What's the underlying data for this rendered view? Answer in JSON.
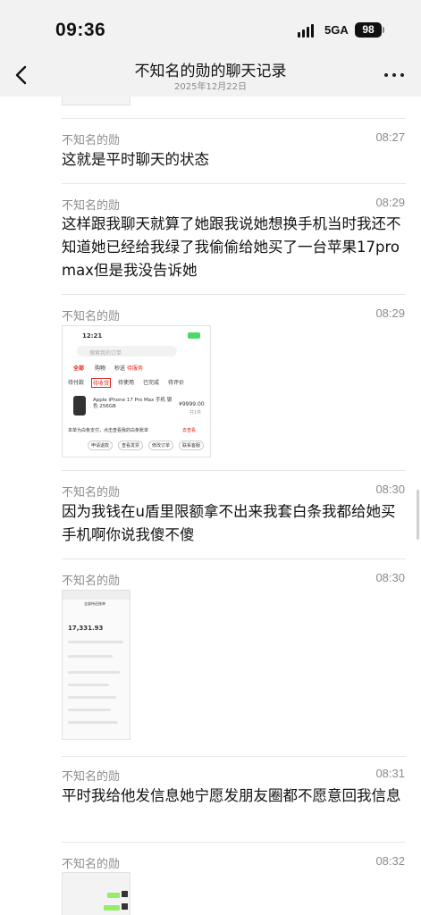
{
  "status_bar": {
    "time": "09:36",
    "network": "5GA",
    "battery": "98"
  },
  "nav": {
    "title": "不知名的勋的聊天记录",
    "subtitle": "2025年12月22日"
  },
  "messages": [
    {
      "sender": "不知名的勋",
      "time": "08:27",
      "text": "这就是平时聊天的状态"
    },
    {
      "sender": "不知名的勋",
      "time": "08:29",
      "text": "这样跟我聊天就算了她跟我说她想换手机当时我还不知道她已经给我绿了我偷偷给她买了一台苹果17pro max但是我没告诉她"
    },
    {
      "sender": "不知名的勋",
      "time": "08:29",
      "image": "order-screenshot"
    },
    {
      "sender": "不知名的勋",
      "time": "08:30",
      "text": "因为我钱在u盾里限额拿不出来我套白条我都给她买手机啊你说我傻不傻"
    },
    {
      "sender": "不知名的勋",
      "time": "08:30",
      "image": "bill-screenshot"
    },
    {
      "sender": "不知名的勋",
      "time": "08:31",
      "text": "平时我给他发信息她宁愿发朋友圈都不愿意回我信息"
    },
    {
      "sender": "不知名的勋",
      "time": "08:32",
      "image": "chat-screenshot"
    }
  ],
  "order_thumb": {
    "time": "12:21",
    "search_placeholder": "搜索我的订单",
    "tabs": [
      "全部",
      "购物",
      "秒送"
    ],
    "badge": "待服务",
    "filters": [
      "待付款",
      "待收货",
      "待使用",
      "已完成",
      "待评价"
    ],
    "product_name": "Apple iPhone 17 Pro Max 手机 银色 256GB",
    "price": "¥9999.00",
    "qty": "共1件",
    "notice": "本单为白条支付，点击查看我的白条账单",
    "notice_link": "去查看",
    "buttons": [
      "申请退款",
      "查看发票",
      "修改订单",
      "联系客服"
    ]
  },
  "bill_thumb": {
    "title": "全部待还账单",
    "amount": "17,331.93"
  }
}
